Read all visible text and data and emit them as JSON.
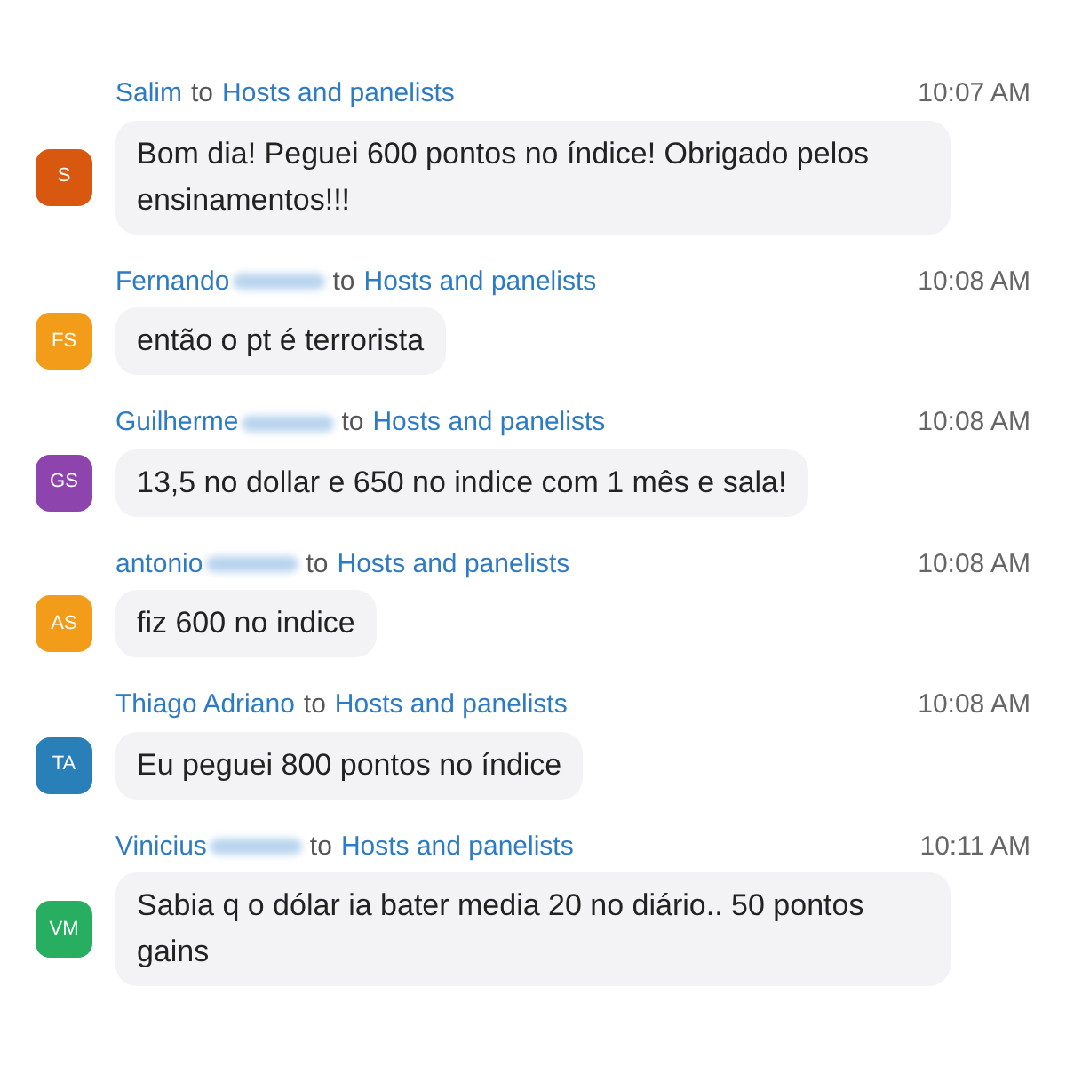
{
  "messages": [
    {
      "sender": "Salim",
      "redacted": false,
      "to": "to",
      "recipient": "Hosts and panelists",
      "time": "10:07 AM",
      "initials": "S",
      "color": "#d9580f",
      "text": "Bom dia! Peguei 600 pontos no índice! Obrigado pelos ensinamentos!!!"
    },
    {
      "sender": "Fernando",
      "redacted": true,
      "to": "to",
      "recipient": "Hosts and panelists",
      "time": "10:08 AM",
      "initials": "FS",
      "color": "#f39c19",
      "text": "então o pt é terrorista"
    },
    {
      "sender": "Guilherme",
      "redacted": true,
      "to": "to",
      "recipient": "Hosts and panelists",
      "time": "10:08 AM",
      "initials": "GS",
      "color": "#8e44ad",
      "text": "13,5 no dollar e 650 no indice com 1 mês e sala!"
    },
    {
      "sender": "antonio",
      "redacted": true,
      "to": "to",
      "recipient": "Hosts and panelists",
      "time": "10:08 AM",
      "initials": "AS",
      "color": "#f39c19",
      "text": "fiz 600 no indice"
    },
    {
      "sender": "Thiago Adriano",
      "redacted": false,
      "to": "to",
      "recipient": "Hosts and panelists",
      "time": "10:08 AM",
      "initials": "TA",
      "color": "#2980b9",
      "text": "Eu peguei 800 pontos no índice"
    },
    {
      "sender": "Vinicius",
      "redacted": true,
      "to": "to",
      "recipient": "Hosts and panelists",
      "time": "10:11 AM",
      "initials": "VM",
      "color": "#27ae60",
      "text": "Sabia q o dólar ia bater media 20 no diário.. 50 pontos gains"
    }
  ]
}
